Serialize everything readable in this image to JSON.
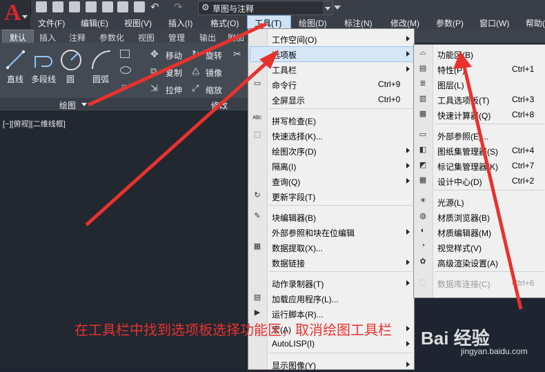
{
  "window": {
    "workspace": "草图与注释"
  },
  "menubar": [
    "文件(F)",
    "编辑(E)",
    "视图(V)",
    "插入(I)",
    "格式(O)",
    "工具(T)",
    "绘图(D)",
    "标注(N)",
    "修改(M)",
    "参数(P)",
    "窗口(W)",
    "帮助("
  ],
  "tabs": [
    "默认",
    "插入",
    "注释",
    "参数化",
    "视图",
    "管理",
    "输出",
    "附加"
  ],
  "ribbon": {
    "line": "直线",
    "polyline": "多段线",
    "circle": "圆",
    "arc": "圆弧",
    "move": "移动",
    "rotate": "旋转",
    "copy": "复制",
    "mirror": "镜像",
    "stretch": "拉伸",
    "scale": "缩放",
    "draw_panel": "绘图",
    "modify_panel": "修改"
  },
  "viewport_label": "[−][俯视][二维线框]",
  "tools_menu": [
    {
      "label": "工作空间(O)",
      "shortcut": "",
      "arrow": true,
      "icon": ""
    },
    {
      "label": "选项板",
      "shortcut": "",
      "arrow": true,
      "icon": "",
      "highlight": true
    },
    {
      "label": "工具栏",
      "shortcut": "",
      "arrow": true,
      "icon": ""
    },
    {
      "label": "命令行",
      "shortcut": "Ctrl+9",
      "arrow": false,
      "icon": "cmd"
    },
    {
      "label": "全屏显示",
      "shortcut": "Ctrl+0",
      "arrow": false,
      "icon": ""
    },
    {
      "label": "拼写检查(E)",
      "shortcut": "",
      "arrow": false,
      "icon": "abc"
    },
    {
      "label": "快速选择(K)...",
      "shortcut": "",
      "arrow": false,
      "icon": "sel"
    },
    {
      "label": "绘图次序(D)",
      "shortcut": "",
      "arrow": true,
      "icon": ""
    },
    {
      "label": "隔离(I)",
      "shortcut": "",
      "arrow": true,
      "icon": ""
    },
    {
      "label": "查询(Q)",
      "shortcut": "",
      "arrow": true,
      "icon": ""
    },
    {
      "label": "更新字段(T)",
      "shortcut": "",
      "arrow": false,
      "icon": "fld"
    },
    {
      "label": "块编辑器(B)",
      "shortcut": "",
      "arrow": false,
      "icon": "blk"
    },
    {
      "label": "外部参照和块在位编辑",
      "shortcut": "",
      "arrow": true,
      "icon": ""
    },
    {
      "label": "数据提取(X)...",
      "shortcut": "",
      "arrow": false,
      "icon": "tbl"
    },
    {
      "label": "数据链接",
      "shortcut": "",
      "arrow": true,
      "icon": ""
    },
    {
      "label": "动作录制器(T)",
      "shortcut": "",
      "arrow": true,
      "icon": ""
    },
    {
      "label": "加载应用程序(L)...",
      "shortcut": "",
      "arrow": false,
      "icon": "app"
    },
    {
      "label": "运行脚本(R)...",
      "shortcut": "",
      "arrow": false,
      "icon": "scr"
    },
    {
      "label": "宏(A)",
      "shortcut": "",
      "arrow": true,
      "icon": ""
    },
    {
      "label": "AutoLISP(I)",
      "shortcut": "",
      "arrow": true,
      "icon": ""
    },
    {
      "label": "显示图像(Y)",
      "shortcut": "",
      "arrow": true,
      "icon": ""
    }
  ],
  "palette_submenu": [
    {
      "label": "功能区(B)",
      "shortcut": "",
      "icon": "rib",
      "disabled": false
    },
    {
      "label": "特性(P)",
      "shortcut": "Ctrl+1",
      "icon": "prop",
      "disabled": false
    },
    {
      "label": "图层(L)",
      "shortcut": "",
      "icon": "lyr",
      "disabled": false
    },
    {
      "label": "工具选项板(T)",
      "shortcut": "Ctrl+3",
      "icon": "tp",
      "disabled": false
    },
    {
      "label": "快速计算器(Q)",
      "shortcut": "Ctrl+8",
      "icon": "calc",
      "disabled": false
    },
    {
      "label": "外部参照(E)...",
      "shortcut": "",
      "icon": "xref",
      "disabled": false
    },
    {
      "label": "图纸集管理器(S)",
      "shortcut": "Ctrl+4",
      "icon": "ss",
      "disabled": false
    },
    {
      "label": "标记集管理器(K)",
      "shortcut": "Ctrl+7",
      "icon": "mk",
      "disabled": false
    },
    {
      "label": "设计中心(D)",
      "shortcut": "Ctrl+2",
      "icon": "dc",
      "disabled": false
    },
    {
      "label": "光源(L)",
      "shortcut": "",
      "icon": "light",
      "disabled": false
    },
    {
      "label": "材质浏览器(B)",
      "shortcut": "",
      "icon": "mat",
      "disabled": false
    },
    {
      "label": "材质编辑器(M)",
      "shortcut": "",
      "icon": "mate",
      "disabled": false
    },
    {
      "label": "视觉样式(V)",
      "shortcut": "",
      "icon": "vs",
      "disabled": false
    },
    {
      "label": "高级渲染设置(A)",
      "shortcut": "",
      "icon": "rnd",
      "disabled": false
    },
    {
      "label": "数据库连接(C)",
      "shortcut": "Ctrl+6",
      "icon": "db",
      "disabled": true
    }
  ],
  "annotation": "在工具栏中找到选项板选择功能区，取消绘图工具栏",
  "watermark": {
    "brand": "Bai 经验",
    "url": "jingyan.baidu.com"
  },
  "colors": {
    "arrow": "#e8322e",
    "highlight": "#d5e6f7"
  }
}
